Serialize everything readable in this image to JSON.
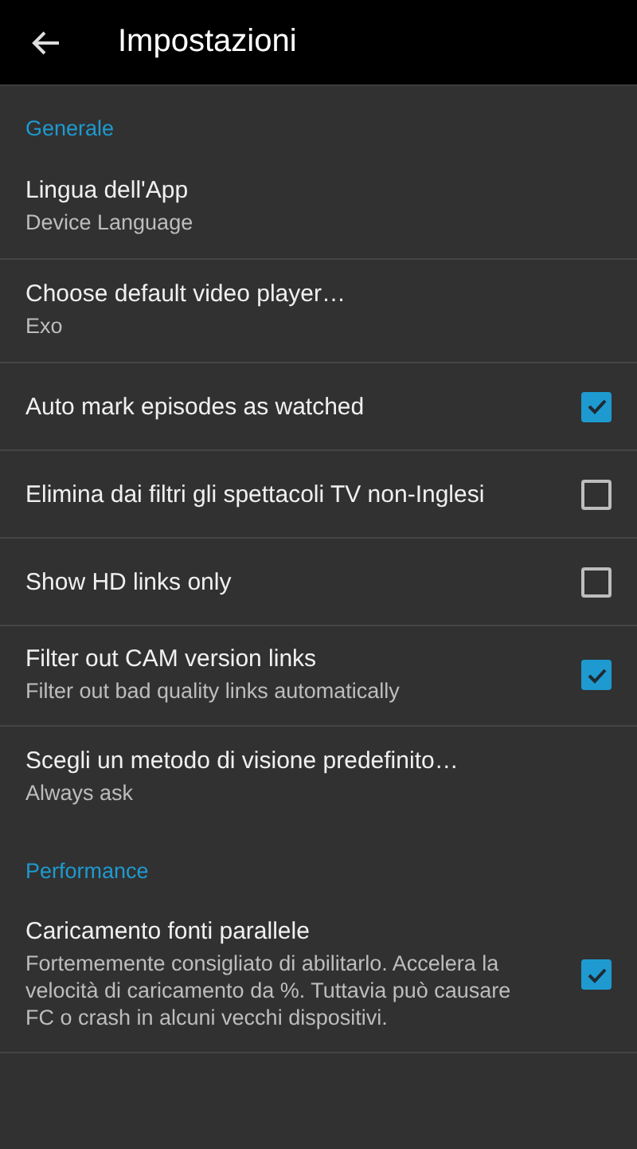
{
  "toolbar": {
    "title": "Impostazioni"
  },
  "sections": [
    {
      "header": "Generale",
      "items": [
        {
          "kind": "link",
          "title": "Lingua dell'App",
          "summary": "Device Language"
        },
        {
          "kind": "link",
          "title": "Choose default video player…",
          "summary": "Exo"
        },
        {
          "kind": "checkbox",
          "title": "Auto mark episodes as watched",
          "checked": true
        },
        {
          "kind": "checkbox",
          "title": "Elimina dai filtri gli spettacoli TV non-Inglesi",
          "checked": false
        },
        {
          "kind": "checkbox",
          "title": "Show HD links only",
          "checked": false
        },
        {
          "kind": "checkbox",
          "title": "Filter out CAM version links",
          "summary": "Filter out bad quality links automatically",
          "checked": true
        },
        {
          "kind": "link",
          "title": "Scegli un metodo di visione predefinito…",
          "summary": "Always ask"
        }
      ]
    },
    {
      "header": "Performance",
      "items": [
        {
          "kind": "checkbox",
          "title": "Caricamento fonti parallele",
          "summary": "Fortememente consigliato di abilitarlo. Accelera la velocità di caricamento da %. Tuttavia può causare FC o crash in alcuni vecchi dispositivi.",
          "checked": true
        }
      ]
    }
  ]
}
